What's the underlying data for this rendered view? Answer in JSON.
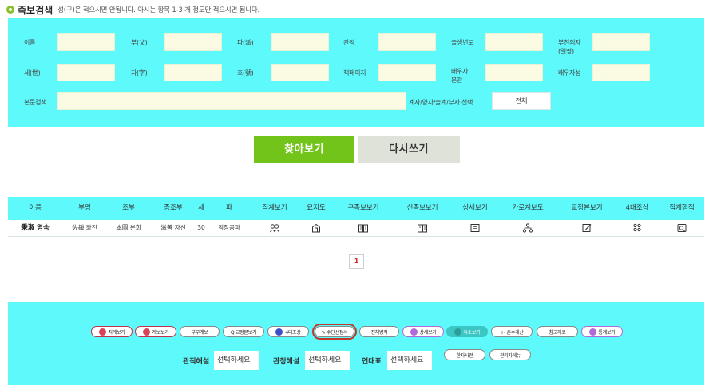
{
  "header": {
    "title": "족보검색",
    "subtitle": "성(구)은 적으시면 안됩니다. 아시는 항목 1-3 개 정도만 적으시면 됩니다."
  },
  "form": {
    "name": "이름",
    "father": "부(父)",
    "pa": "파(派)",
    "official_title": "관직",
    "birth_year": "출생년도",
    "lunar_father": "부친의자\n(일명)",
    "generation": "세(世)",
    "ja": "자(字)",
    "ho": "호(號)",
    "book_page": "책페이지",
    "spouse_clan": "배우자\n본관",
    "spouse_surname": "배우자성",
    "body_search": "본문검색",
    "select_label": "계자/양자/출계/부자 선택",
    "select_value": "전체"
  },
  "buttons": {
    "search": "찾아보기",
    "reset": "다시쓰기"
  },
  "table": {
    "headers": [
      "이름",
      "부명",
      "조부",
      "증조부",
      "세",
      "파",
      "직계보기",
      "묘지도",
      "구족보보기",
      "신족보보기",
      "상세보기",
      "가로계보도",
      "교정본보기",
      "4대조상",
      "직계행적"
    ],
    "row": {
      "name": "秉淑 영숙",
      "father": "佐鎭 좌진",
      "grandfather": "本圖 본희",
      "great_grandfather": "滋善 자선",
      "generation": "30",
      "pa": "직장공파"
    },
    "page": "1"
  },
  "bottom_buttons": [
    {
      "label": "직계보기",
      "style": "red",
      "icon_color": "#d9435a"
    },
    {
      "label": "계보보기",
      "style": "red",
      "icon_color": "#d9435a"
    },
    {
      "label": "부부계보",
      "style": "plain"
    },
    {
      "label": "Q 교정본보기",
      "style": "plain"
    },
    {
      "label": "4대조상",
      "style": "plain",
      "icon_color": "#3a4fc9"
    },
    {
      "label": "✎ 수단선정서",
      "style": "plain",
      "highlight": true
    },
    {
      "label": "전체병적",
      "style": "plain"
    },
    {
      "label": "상세보기",
      "style": "purple",
      "icon_color": "#b36ad9"
    },
    {
      "label": "유소보기",
      "style": "teal"
    },
    {
      "label": "+- 촌수계산",
      "style": "plain"
    },
    {
      "label": "참고자료",
      "style": "plain"
    },
    {
      "label": "통계보기",
      "style": "purple",
      "icon_color": "#b36ad9"
    },
    {
      "label": "한자사전",
      "style": "plain"
    },
    {
      "label": "관리자메뉴",
      "style": "plain"
    }
  ],
  "bottom_selects": {
    "official_label": "관직해설",
    "official_value": "선택하세요",
    "office_label": "관청해설",
    "office_value": "선택하세요",
    "chronology_label": "연대표",
    "chronology_value": "선택하세요"
  },
  "colors": {
    "panel": "#5ef9fb",
    "input_bg": "#fbfbe4",
    "search_button": "#72c41b",
    "reset_button": "#dfe2d9",
    "bullet": "#8bbf2a",
    "page_number": "#d42a2a"
  }
}
